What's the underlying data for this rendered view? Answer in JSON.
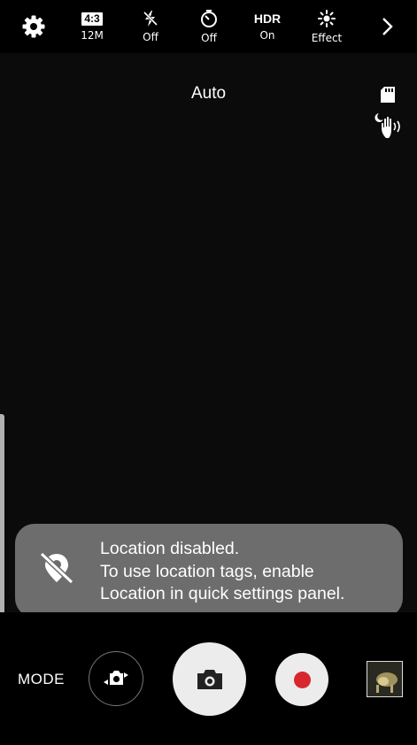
{
  "top_bar": {
    "settings_icon": "gear-icon",
    "picture_size": {
      "ratio": "4:3",
      "label": "12M"
    },
    "flash": {
      "icon": "flash-off-icon",
      "label": "Off"
    },
    "timer": {
      "icon": "timer-icon",
      "label": "Off"
    },
    "hdr": {
      "title": "HDR",
      "label": "On"
    },
    "effect": {
      "icon": "effect-icon",
      "label": "Effect"
    },
    "more_icon": "chevron-right-icon"
  },
  "viewfinder": {
    "mode": "Auto",
    "storage_icon": "sd-card-icon",
    "gesture_icon": "palm-gesture-icon"
  },
  "toast": {
    "icon": "location-off-icon",
    "lines": [
      "Location disabled.",
      "To use location tags, enable",
      "Location in quick settings panel."
    ]
  },
  "bottom_bar": {
    "mode_label": "MODE",
    "switch_camera_icon": "switch-camera-icon",
    "shutter_icon": "camera-icon",
    "record_icon": "record-icon",
    "gallery_icon": "gallery-thumbnail",
    "record_color": "#d8272e"
  }
}
